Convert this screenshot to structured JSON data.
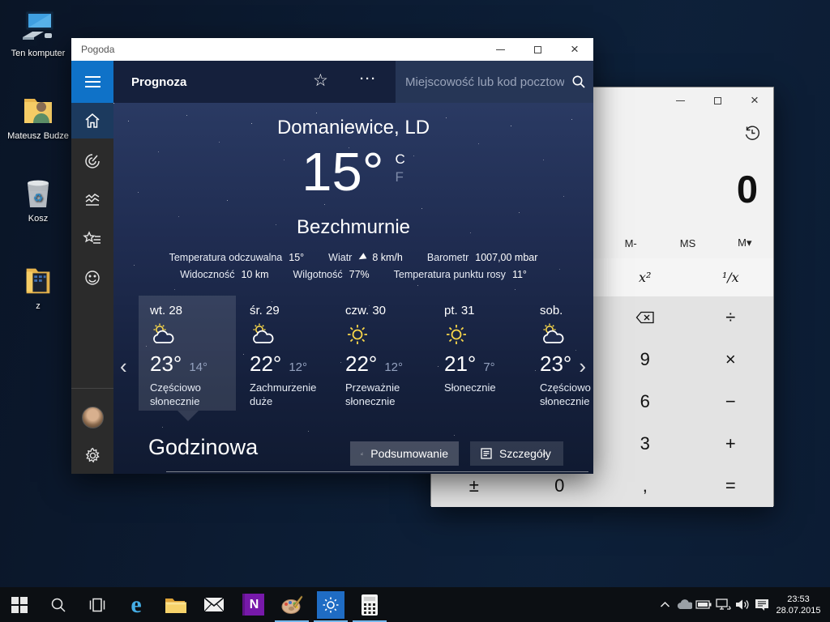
{
  "colors": {
    "accent_blue": "#0f72c8",
    "weather_tile_blue": "#1f6cc4",
    "header_navy": "#15203c",
    "sidebar_gray": "#2b2b2b"
  },
  "desktop": {
    "icons": [
      {
        "label": "Ten komputer"
      },
      {
        "label": "Mateusz Budze"
      },
      {
        "label": "Kosz"
      },
      {
        "label": "z"
      }
    ]
  },
  "weather": {
    "window_title": "Pogoda",
    "nav_title": "Prognoza",
    "more_label": "···",
    "search_placeholder": "Miejscowość lub kod pocztowy",
    "location": "Domaniewice, LD",
    "temperature": "15°",
    "unit_celsius": "C",
    "unit_fahrenheit": "F",
    "condition": "Bezchmurnie",
    "details": [
      {
        "label": "Temperatura odczuwalna",
        "value": "15°"
      },
      {
        "label": "Wiatr",
        "value": "8 km/h"
      },
      {
        "label": "Barometr",
        "value": "1007,00 mbar"
      },
      {
        "label": "Widoczność",
        "value": "10 km"
      },
      {
        "label": "Wilgotność",
        "value": "77%"
      },
      {
        "label": "Temperatura punktu rosy",
        "value": "11°"
      }
    ],
    "daily": [
      {
        "day": "wt. 28",
        "high": "23°",
        "low": "14°",
        "condition": "Częściowo słonecznie",
        "icon": "partly-sunny",
        "selected": true
      },
      {
        "day": "śr. 29",
        "high": "22°",
        "low": "12°",
        "condition": "Zachmurzenie duże",
        "icon": "partly-sunny",
        "selected": false
      },
      {
        "day": "czw. 30",
        "high": "22°",
        "low": "12°",
        "condition": "Przeważnie słonecznie",
        "icon": "sunny",
        "selected": false
      },
      {
        "day": "pt. 31",
        "high": "21°",
        "low": "7°",
        "condition": "Słonecznie",
        "icon": "sunny",
        "selected": false
      },
      {
        "day": "sob.",
        "high": "23°",
        "low": "",
        "condition": "Częściowo słonecznie",
        "icon": "partly-sunny",
        "selected": false
      }
    ],
    "hourly_heading": "Godzinowa",
    "summary_button": "Podsumowanie",
    "details_button": "Szczegóły"
  },
  "calculator": {
    "display": "0",
    "memory_row": [
      "",
      "",
      "",
      "M-",
      "MS",
      "M▾"
    ],
    "backspace_key": "⌫",
    "keys": [
      [
        "",
        "",
        "x²",
        "¹/x"
      ],
      [
        "",
        "",
        "",
        "÷"
      ],
      [
        "",
        "",
        "9",
        "×"
      ],
      [
        "",
        "",
        "6",
        "−"
      ],
      [
        "",
        "",
        "3",
        "+"
      ],
      [
        "±",
        "0",
        ",",
        "="
      ]
    ]
  },
  "taskbar": {
    "time": "23:53",
    "date": "28.07.2015"
  }
}
